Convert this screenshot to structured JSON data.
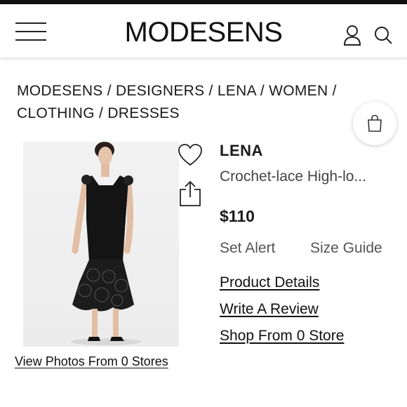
{
  "header": {
    "logo": "MODESENS",
    "menu_icon": "hamburger-menu-icon",
    "user_icon": "user-icon",
    "search_icon": "search-icon"
  },
  "breadcrumb": {
    "items": [
      "MODESENS",
      "DESIGNERS",
      "LENA",
      "WOMEN",
      "CLOTHING",
      "DRESSES"
    ],
    "separator": " / "
  },
  "floating": {
    "bag_icon": "shopping-bag-icon"
  },
  "product": {
    "brand": "LENA",
    "name": "Crochet-lace High-lo...",
    "price": "$110",
    "image_desc_icon": "product-photo",
    "favorite_icon": "heart-icon",
    "share_icon": "share-icon"
  },
  "actions": {
    "set_alert": "Set Alert",
    "size_guide": "Size Guide",
    "product_details": "Product Details",
    "write_review": "Write A Review",
    "shop_from": "Shop From 0 Store",
    "view_photos": "View Photos From 0 Stores"
  },
  "colors": {
    "text": "#1a1a1a",
    "muted": "#555555",
    "accent": "#111111",
    "background": "#ffffff"
  }
}
